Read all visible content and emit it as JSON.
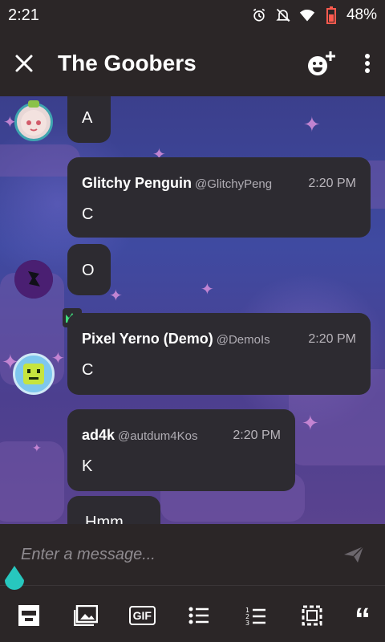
{
  "status": {
    "time": "2:21",
    "battery": "48%"
  },
  "header": {
    "title": "The Goobers"
  },
  "messages": [
    {
      "text": "A"
    },
    {
      "name": "Glitchy Penguin",
      "handle": "@GlitchyPeng",
      "time": "2:20 PM",
      "text": "C"
    },
    {
      "text": "O"
    },
    {
      "name": "Pixel Yerno (Demo)",
      "handle": "@DemoIs",
      "time": "2:20 PM",
      "text": "C"
    },
    {
      "name": "ad4k",
      "handle": "@autdum4Kos",
      "time": "2:20 PM",
      "text": "K"
    },
    {
      "text": "Hmm"
    }
  ],
  "composer": {
    "placeholder": "Enter a message..."
  },
  "toolbar": {
    "gif": "GIF",
    "quote": "“"
  },
  "colors": {
    "accent": "#27c7be",
    "bubble": "#2d2b31",
    "bar": "#2b2627"
  },
  "icons": [
    "close-icon",
    "add-emoji-icon",
    "more-vert-icon",
    "send-icon",
    "sticker-icon",
    "image-icon",
    "gif-icon",
    "bulleted-list-icon",
    "numbered-list-icon",
    "selection-icon",
    "quote-icon"
  ]
}
